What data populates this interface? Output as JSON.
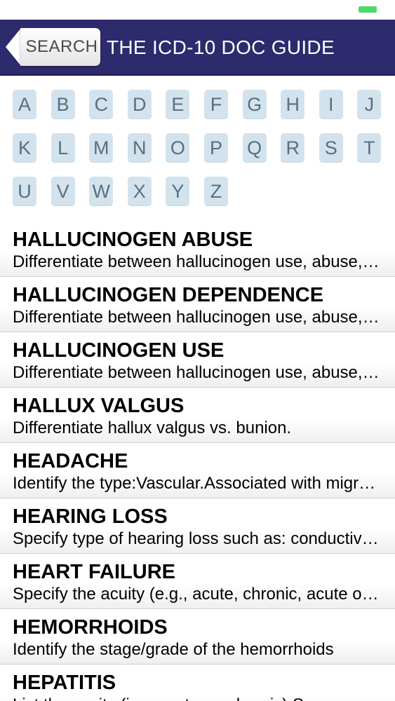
{
  "nav": {
    "back_label": "SEARCH",
    "title": "THE ICD-10 DOC GUIDE"
  },
  "alphabet": [
    "A",
    "B",
    "C",
    "D",
    "E",
    "F",
    "G",
    "H",
    "I",
    "J",
    "K",
    "L",
    "M",
    "N",
    "O",
    "P",
    "Q",
    "R",
    "S",
    "T",
    "U",
    "V",
    "W",
    "X",
    "Y",
    "Z"
  ],
  "entries": [
    {
      "title": "HALLUCINOGEN ABUSE",
      "subtitle": "Differentiate between hallucinogen use, abuse, and dependence."
    },
    {
      "title": "HALLUCINOGEN DEPENDENCE",
      "subtitle": "Differentiate between hallucinogen use, abuse, and dependence."
    },
    {
      "title": "HALLUCINOGEN USE",
      "subtitle": "Differentiate between hallucinogen use, abuse, and dependence."
    },
    {
      "title": "HALLUX VALGUS",
      "subtitle": "Differentiate hallux valgus vs. bunion."
    },
    {
      "title": "HEADACHE",
      "subtitle": "Identify the type:Vascular.Associated with migraine"
    },
    {
      "title": "HEARING LOSS",
      "subtitle": "Specify type of hearing loss such as: conductive, sensorineural"
    },
    {
      "title": "HEART FAILURE",
      "subtitle": "Specify the acuity (e.g., acute, chronic, acute on chronic)"
    },
    {
      "title": "HEMORRHOIDS",
      "subtitle": "Identify the stage/grade of the hemorrhoids"
    },
    {
      "title": "HEPATITIS",
      "subtitle": "List the acuity (i.e., acute, or chronic) S"
    }
  ],
  "colors": {
    "nav_bg": "#2d2a6d",
    "key_bg": "#d3e3ee",
    "key_text": "#5a6f7e",
    "battery": "#4cd964"
  }
}
